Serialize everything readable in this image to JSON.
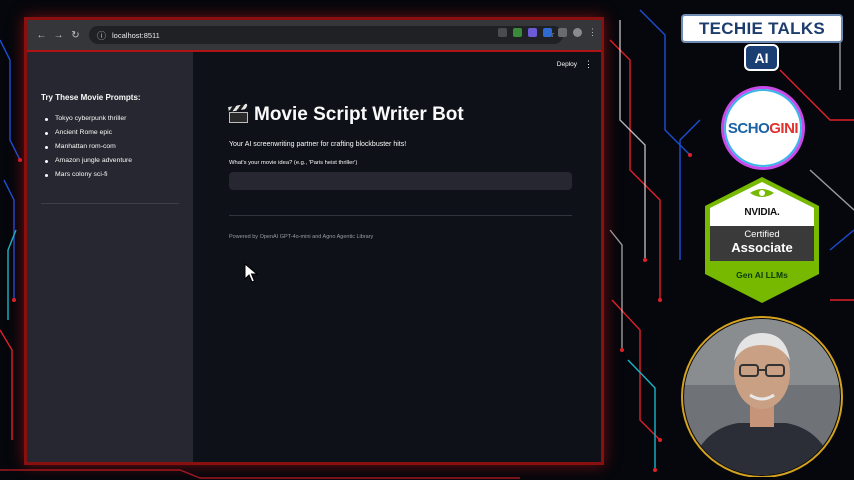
{
  "browser": {
    "url": "localhost:8511",
    "accent": "#b01313"
  },
  "app": {
    "deploy_label": "Deploy",
    "title": "Movie Script Writer Bot",
    "subtitle": "Your AI screenwriting partner for crafting blockbuster hits!",
    "input_label": "What's your movie idea? (e.g., 'Paris heist thriller')",
    "input_value": "",
    "footer": "Powered by OpenAI GPT-4o-mini and Agno Agentic Library"
  },
  "sidebar": {
    "title": "Try These Movie Prompts:",
    "items": [
      {
        "label": "Tokyo cyberpunk thriller"
      },
      {
        "label": "Ancient Rome epic"
      },
      {
        "label": "Manhattan rom-com"
      },
      {
        "label": "Amazon jungle adventure"
      },
      {
        "label": "Mars colony sci-fi"
      }
    ]
  },
  "overlay": {
    "channel": "TECHIE TALKS",
    "ai": "AI",
    "brand_main": "SCHO",
    "brand_accent": "GINI",
    "badge_vendor": "NVIDIA.",
    "badge_certified": "Certified",
    "badge_level": "Associate",
    "badge_track": "Gen AI LLMs"
  }
}
